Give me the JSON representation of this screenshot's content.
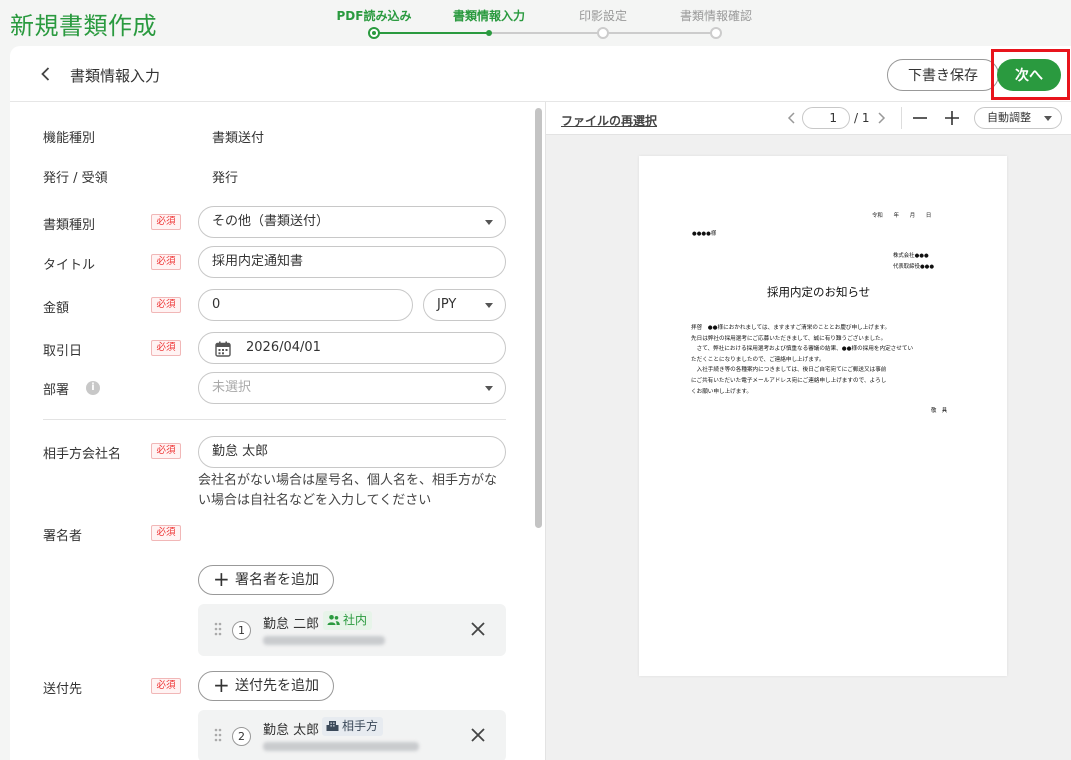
{
  "app": {
    "title": "新規書類作成"
  },
  "stepper": {
    "steps": [
      {
        "label": "PDF読み込み",
        "state": "done"
      },
      {
        "label": "書類情報入力",
        "state": "active"
      },
      {
        "label": "印影設定",
        "state": "pending"
      },
      {
        "label": "書類情報確認",
        "state": "pending"
      }
    ]
  },
  "header": {
    "title": "書類情報入力",
    "draft_label": "下書き保存",
    "next_label": "次へ"
  },
  "form": {
    "required_badge": "必須",
    "function_type": {
      "label": "機能種別",
      "value": "書類送付"
    },
    "issue_receive": {
      "label": "発行 / 受領",
      "value": "発行"
    },
    "doc_type": {
      "label": "書類種別",
      "value": "その他（書類送付）"
    },
    "title": {
      "label": "タイトル",
      "value": "採用内定通知書"
    },
    "amount": {
      "label": "金額",
      "value": "0",
      "currency": "JPY"
    },
    "trade_date": {
      "label": "取引日",
      "value": "2026/04/01"
    },
    "department": {
      "label": "部署",
      "placeholder": "未選択",
      "info_icon": "i"
    },
    "partner_company": {
      "label": "相手方会社名",
      "value": "勤怠 太郎",
      "helper": "会社名がない場合は屋号名、個人名を、相手方がない場合は自社名などを入力してください"
    },
    "signers": {
      "label": "署名者",
      "add_label": "署名者を追加",
      "items": [
        {
          "index": "1",
          "name": "勤怠 二郎",
          "tag": "社内"
        }
      ]
    },
    "recipients": {
      "label": "送付先",
      "add_label": "送付先を追加",
      "items": [
        {
          "index": "2",
          "name": "勤怠 太郎",
          "tag": "相手方"
        }
      ]
    }
  },
  "preview": {
    "reselect_label": "ファイルの再選択",
    "page_current": "1",
    "page_total": "/ 1",
    "zoom_label": "自動調整",
    "document": {
      "date_line": "令和　　年　　月　　日",
      "recipient": "●●●●様",
      "company": "株式会社●●●",
      "representative": "代表取締役●●●",
      "heading": "採用内定のお知らせ",
      "body": [
        "拝啓　●●様におかれましては、ますますご清栄のこととお慶び申し上げます。",
        "先日は弊社の採用選考にご応募いただきまして、誠に有り難うございました。",
        "　さて、弊社における採用選考および慎重なる審議の結果、●●様の採用を内定させてい",
        "ただくことになりましたので、ご連絡申し上げます。",
        "　入社手続き等の各種案内につきましては、後日ご自宅宛てにご郵送又は事前",
        "にご共有いただいた電子メールアドレス宛にご連絡申し上げますので、よろし",
        "くお願い申し上げます。"
      ],
      "closing": "敬　具"
    }
  },
  "colors": {
    "brand": "#2a9a3f",
    "required": "#e33333",
    "highlight": "#e8141c"
  }
}
